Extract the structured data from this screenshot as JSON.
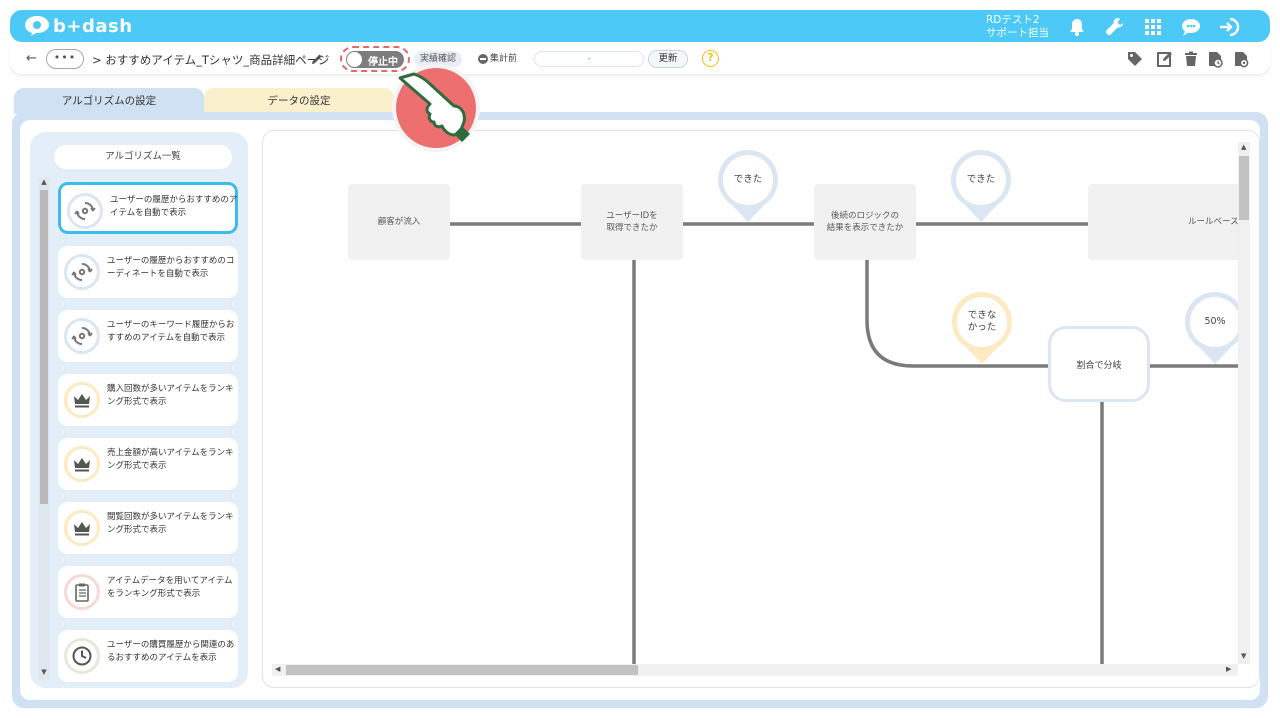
{
  "header": {
    "logo_text": "b+dash",
    "user_line1": "RDテスト2",
    "user_line2": "サポート担当",
    "brand_color": "#4cc9f7",
    "icons": [
      "bell-icon",
      "wrench-icon",
      "grid-icon",
      "chat-icon",
      "logout-icon"
    ]
  },
  "toolbar": {
    "back": "←",
    "more": "•••",
    "breadcrumb": "> おすすめアイテム_Tシャツ_商品詳細ページ",
    "toggle_label": "停止中",
    "chip_label": "実績確認",
    "status_label": "集計前",
    "date_value": "-",
    "update_label": "更新",
    "help": "?",
    "action_icons": [
      "tag-icon",
      "edit-icon",
      "trash-icon",
      "history-icon",
      "settings-file-icon"
    ]
  },
  "tabs": {
    "algorithm": "アルゴリズムの設定",
    "data": "データの設定"
  },
  "sidebar": {
    "title": "アルゴリズム一覧",
    "items": [
      {
        "label": "ユーザーの履歴からおすすめのアイテムを自動で表示",
        "icon": "sync-gear-icon",
        "active": true
      },
      {
        "label": "ユーザーの履歴からおすすめのコーディネートを自動で表示",
        "icon": "sync-gear-icon",
        "active": false
      },
      {
        "label": "ユーザーのキーワード履歴からおすすめのアイテムを自動で表示",
        "icon": "sync-gear-icon",
        "active": false
      },
      {
        "label": "購入回数が多いアイテムをランキング形式で表示",
        "icon": "crown-icon",
        "active": false
      },
      {
        "label": "売上金額が高いアイテムをランキング形式で表示",
        "icon": "crown-icon",
        "active": false
      },
      {
        "label": "閲覧回数が多いアイテムをランキング形式で表示",
        "icon": "crown-icon",
        "active": false
      },
      {
        "label": "アイテムデータを用いてアイテムをランキング形式で表示",
        "icon": "clipboard-icon",
        "active": false
      },
      {
        "label": "ユーザーの購買履歴から関連のあるおすすめのアイテムを表示",
        "icon": "clock-icon",
        "active": false
      }
    ]
  },
  "flow": {
    "node_inflow": "顧客が流入",
    "node_userid_1": "ユーザーIDを",
    "node_userid_2": "取得できたか",
    "node_logic_1": "後続のロジックの",
    "node_logic_2": "結果を表示できたか",
    "node_rule": "ルールベース",
    "node_split": "割合で分岐",
    "bubble_yes_1": "できた",
    "bubble_yes_2": "できた",
    "bubble_no_1": "できな",
    "bubble_no_2": "かった",
    "bubble_pct": "50%"
  }
}
